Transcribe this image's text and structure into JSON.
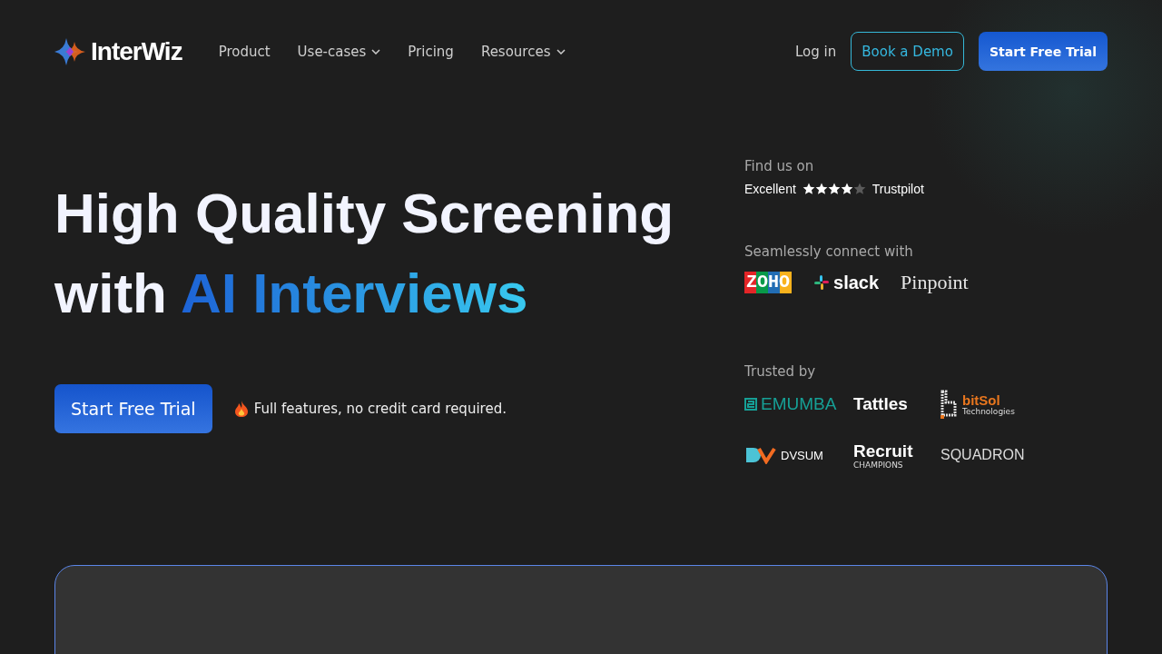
{
  "header": {
    "logo": "InterWiz",
    "nav": [
      {
        "label": "Product",
        "dropdown": false
      },
      {
        "label": "Use-cases",
        "dropdown": true
      },
      {
        "label": "Pricing",
        "dropdown": false
      },
      {
        "label": "Resources",
        "dropdown": true
      }
    ],
    "login": "Log in",
    "demo_button": "Book a Demo",
    "trial_button": "Start Free Trial"
  },
  "hero": {
    "headline_line1": "High Quality Screening",
    "headline_plain": "with ",
    "headline_highlight": "AI Interviews",
    "cta": "Start Free Trial",
    "note": "Full features, no credit card required."
  },
  "trustpilot": {
    "heading": "Find us on",
    "rating": "Excellent",
    "stars": 4,
    "brand": "Trustpilot"
  },
  "integrations": {
    "heading": "Seamlessly connect with",
    "logos": [
      {
        "kind": "zoho",
        "text": "ZOHO"
      },
      {
        "kind": "slack",
        "text": "slack"
      },
      {
        "kind": "pinpoint",
        "text": "Pinpoint"
      }
    ]
  },
  "trusted": {
    "heading": "Trusted by",
    "logos": [
      {
        "kind": "emumba",
        "text": "EMUMBA"
      },
      {
        "kind": "tattles",
        "text": "Tattles"
      },
      {
        "kind": "bitsol",
        "text": "bitSol",
        "subtext": "Technologies"
      },
      {
        "kind": "dvsum",
        "text": "DVSUM"
      },
      {
        "kind": "recruit",
        "text": "Recruit",
        "subtext": "CHAMPIONS"
      },
      {
        "kind": "squadron",
        "text": "SQUADRON"
      }
    ]
  }
}
